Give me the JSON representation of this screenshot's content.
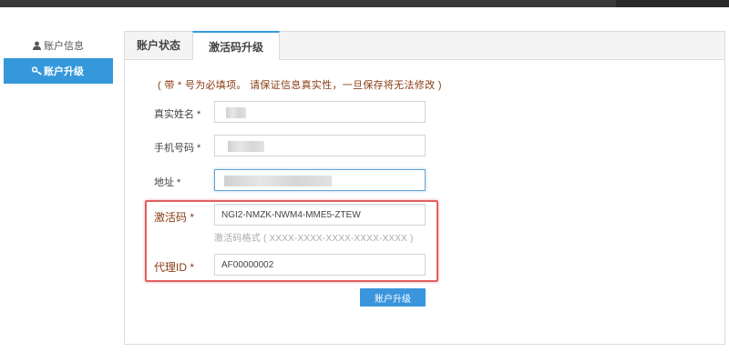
{
  "sidebar": {
    "items": [
      {
        "label": "账户信息",
        "icon": "user-icon"
      },
      {
        "label": "账户升级",
        "icon": "key-icon",
        "active": true
      }
    ]
  },
  "tabs": [
    {
      "label": "账户状态"
    },
    {
      "label": "激活码升级",
      "active": true
    }
  ],
  "form": {
    "notice": "( 带 * 号为必填项。 请保证信息真实性，一旦保存将无法修改 )",
    "real_name": {
      "label": "真实姓名 *",
      "value": ""
    },
    "phone": {
      "label": "手机号码 *",
      "value": ""
    },
    "address": {
      "label": "地址 *",
      "value": ""
    },
    "activation_code": {
      "label": "激活码 *",
      "value": "NGI2-NMZK-NWM4-MME5-ZTEW",
      "hint": "激活码格式 ( XXXX-XXXX-XXXX-XXXX-XXXX )"
    },
    "agent_id": {
      "label": "代理ID *",
      "value": "AF00000002"
    },
    "submit_label": "账户升级"
  },
  "colors": {
    "accent": "#3498db",
    "required_label": "#8a3c14",
    "highlight_border": "#e06060"
  }
}
